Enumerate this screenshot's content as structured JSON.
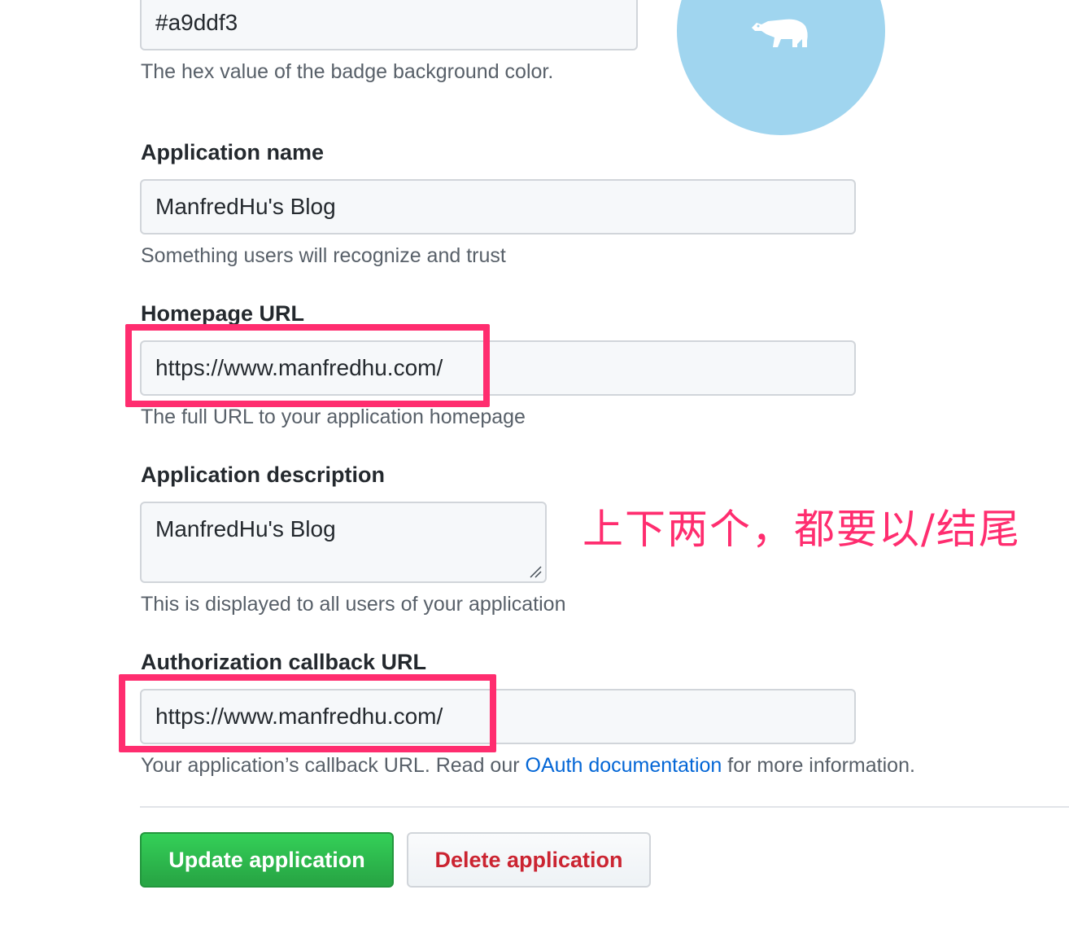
{
  "badge": {
    "color_value": "#a9ddf3",
    "color_hint": "The hex value of the badge background color.",
    "preview_color": "#a0d5ef",
    "icon": "polar-bear-icon"
  },
  "app_name": {
    "label": "Application name",
    "value": "ManfredHu's Blog",
    "hint": "Something users will recognize and trust"
  },
  "homepage": {
    "label": "Homepage URL",
    "value": "https://www.manfredhu.com/",
    "hint": "The full URL to your application homepage"
  },
  "description": {
    "label": "Application description",
    "value": "ManfredHu's Blog",
    "hint": "This is displayed to all users of your application"
  },
  "callback": {
    "label": "Authorization callback URL",
    "value": "https://www.manfredhu.com/",
    "hint_prefix": "Your application’s callback URL. Read our ",
    "hint_link": "OAuth documentation",
    "hint_suffix": " for more information."
  },
  "annotation": {
    "text": "上下两个，都要以/结尾",
    "color": "#ff2d6f"
  },
  "actions": {
    "update_label": "Update application",
    "delete_label": "Delete application"
  },
  "colors": {
    "primary_green": "#2cbe4e",
    "danger_red": "#cb2431",
    "link_blue": "#0366d6"
  }
}
